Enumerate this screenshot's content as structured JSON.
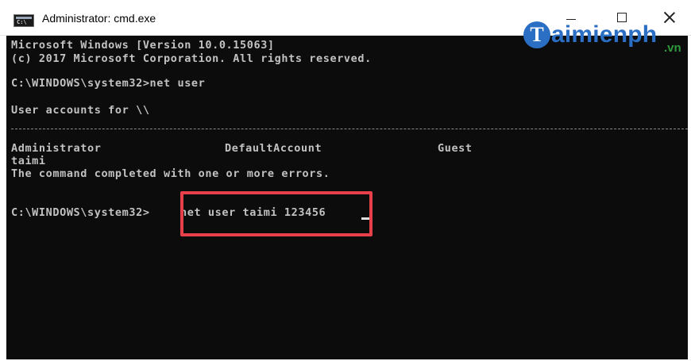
{
  "window": {
    "title": "Administrator: cmd.exe",
    "icon": "cmd-icon",
    "controls": {
      "minimize_icon": "minimize-icon",
      "maximize_icon": "maximize-icon",
      "close_icon": "close-icon"
    }
  },
  "console": {
    "background": "#0c0c0c",
    "text_color": "#c2c2c2",
    "version_line": "Microsoft Windows [Version 10.0.15063]",
    "copyright_line": "(c) 2017 Microsoft Corporation. All rights reserved.",
    "command1_line": "C:\\WINDOWS\\system32>net user",
    "accounts_header": "User accounts for \\\\",
    "accounts": [
      "Administrator",
      "DefaultAccount",
      "Guest",
      "taimi"
    ],
    "result_line": "The command completed with one or more errors.",
    "prompt2": "C:\\WINDOWS\\system32>",
    "command2": "net user taimi 123456"
  },
  "highlight": {
    "color": "#e8404a"
  },
  "watermark": {
    "logo_letter": "T",
    "brand_text": "aimienph",
    "suffix": ".vn",
    "brand_color": "#2a6fc4",
    "suffix_color": "#2e9a3e"
  }
}
